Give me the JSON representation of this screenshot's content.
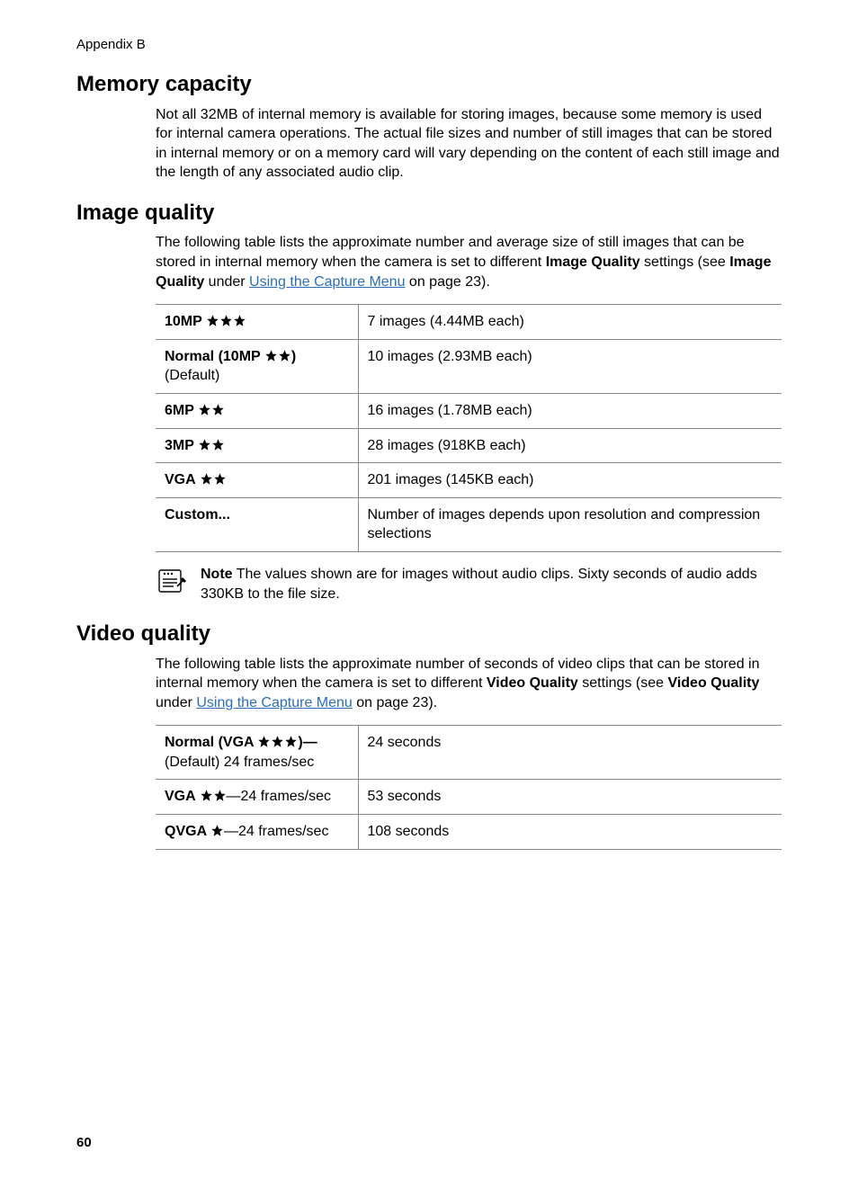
{
  "appendix": "Appendix B",
  "star": "★",
  "sections": {
    "memory": {
      "heading": "Memory capacity",
      "para": "Not all 32MB of internal memory is available for storing images, because some memory is used for internal camera operations. The actual file sizes and number of still images that can be stored in internal memory or on a memory card will vary depending on the content of each still image and the length of any associated audio clip."
    },
    "image": {
      "heading": "Image quality",
      "para": {
        "t1": "The following table lists the approximate number and average size of still images that can be stored in internal memory when the camera is set to different ",
        "b1": "Image Quality",
        "t2": " settings (see ",
        "b2": "Image Quality",
        "t3": " under ",
        "link": "Using the Capture Menu",
        "t4": " on page 23)."
      },
      "rows": [
        {
          "label_bold": "10MP ",
          "stars": 3,
          "label_tail": "",
          "right": "7 images (4.44MB each)"
        },
        {
          "label_bold": "Normal (10MP ",
          "stars": 2,
          "label_tail_bold": ")",
          "sub": "(Default)",
          "right": "10 images (2.93MB each)"
        },
        {
          "label_bold": "6MP ",
          "stars": 2,
          "label_tail": "",
          "right": "16 images (1.78MB each)"
        },
        {
          "label_bold": "3MP ",
          "stars": 2,
          "label_tail": "",
          "right": "28 images (918KB each)"
        },
        {
          "label_bold": "VGA ",
          "stars": 2,
          "label_tail": "",
          "right": "201 images (145KB each)"
        },
        {
          "label_bold": "Custom...",
          "stars": 0,
          "label_tail": "",
          "right": "Number of images depends upon resolution and compression selections"
        }
      ],
      "note": {
        "label": "Note",
        "text": "  The values shown are for images without audio clips. Sixty seconds of audio adds 330KB to the file size."
      }
    },
    "video": {
      "heading": "Video quality",
      "para": {
        "t1": "The following table lists the approximate number of seconds of video clips that can be stored in internal memory when the camera is set to different ",
        "b1": "Video Quality",
        "t2": " settings (see ",
        "b2": "Video Quality",
        "t3": " under ",
        "link": "Using the Capture Menu",
        "t4": " on page 23)."
      },
      "rows": [
        {
          "label_bold": "Normal (VGA ",
          "stars": 3,
          "label_tail_bold": ")—",
          "sub": "(Default) 24 frames/sec",
          "right": "24 seconds"
        },
        {
          "label_bold": "VGA ",
          "stars": 2,
          "label_tail": "—24 frames/sec",
          "right": "53 seconds"
        },
        {
          "label_bold": "QVGA ",
          "stars": 1,
          "label_tail": "—24 frames/sec",
          "right": "108 seconds"
        }
      ]
    }
  },
  "pageNumber": "60"
}
